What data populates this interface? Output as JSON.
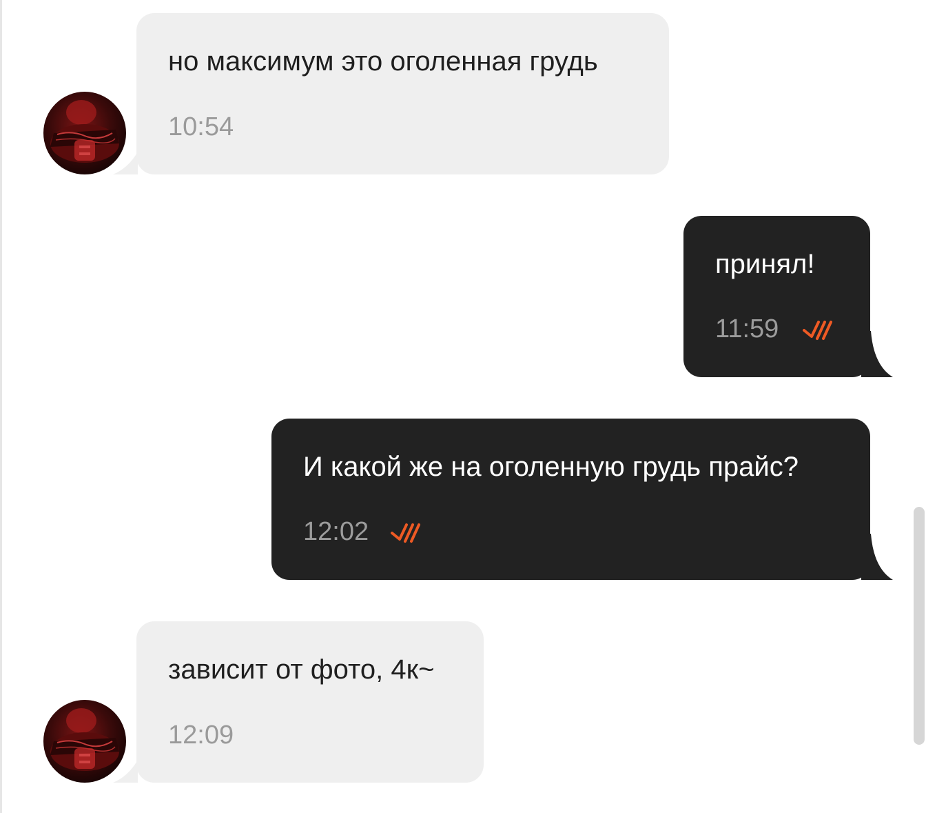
{
  "messages": [
    {
      "direction": "incoming",
      "text": "но максимум это оголенная грудь",
      "time": "10:54"
    },
    {
      "direction": "outgoing",
      "text": "принял!",
      "time": "11:59",
      "status": "read"
    },
    {
      "direction": "outgoing",
      "text": "И какой же на оголенную грудь прайс?",
      "time": "12:02",
      "status": "read"
    },
    {
      "direction": "incoming",
      "text": "зависит от фото, 4к~",
      "time": "12:09"
    }
  ],
  "icons": {
    "read_receipt": "double-check-icon",
    "avatar": "contact-avatar"
  },
  "colors": {
    "incoming_bubble": "#efefef",
    "outgoing_bubble": "#222222",
    "read_check": "#ee5a24",
    "timestamp": "#9a9a9a"
  }
}
